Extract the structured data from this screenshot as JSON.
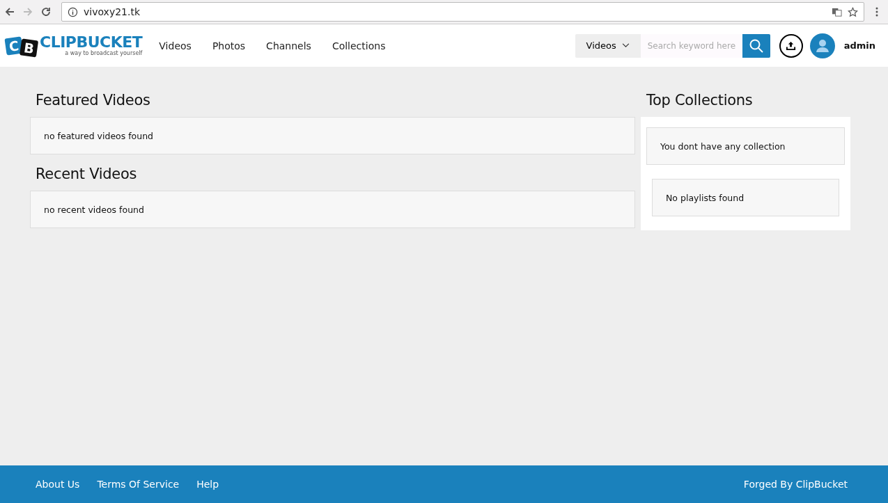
{
  "browser": {
    "url": "vivoxy21.tk"
  },
  "logo": {
    "letters": [
      "C",
      "B"
    ],
    "name": "CLIPBUCKET",
    "tagline": "a way to broadcast yourself"
  },
  "nav": [
    "Videos",
    "Photos",
    "Channels",
    "Collections"
  ],
  "search": {
    "scope": "Videos",
    "placeholder": "Search keyword here"
  },
  "user": {
    "name": "admin"
  },
  "main": [
    {
      "title": "Featured Videos",
      "message": "no featured videos found"
    },
    {
      "title": "Recent Videos",
      "message": "no recent videos found"
    }
  ],
  "side": {
    "title": "Top Collections",
    "messages": [
      "You dont have any collection",
      "No playlists found"
    ]
  },
  "footer": {
    "links": [
      "About Us",
      "Terms Of Service",
      "Help"
    ],
    "credit": "Forged By ClipBucket"
  }
}
